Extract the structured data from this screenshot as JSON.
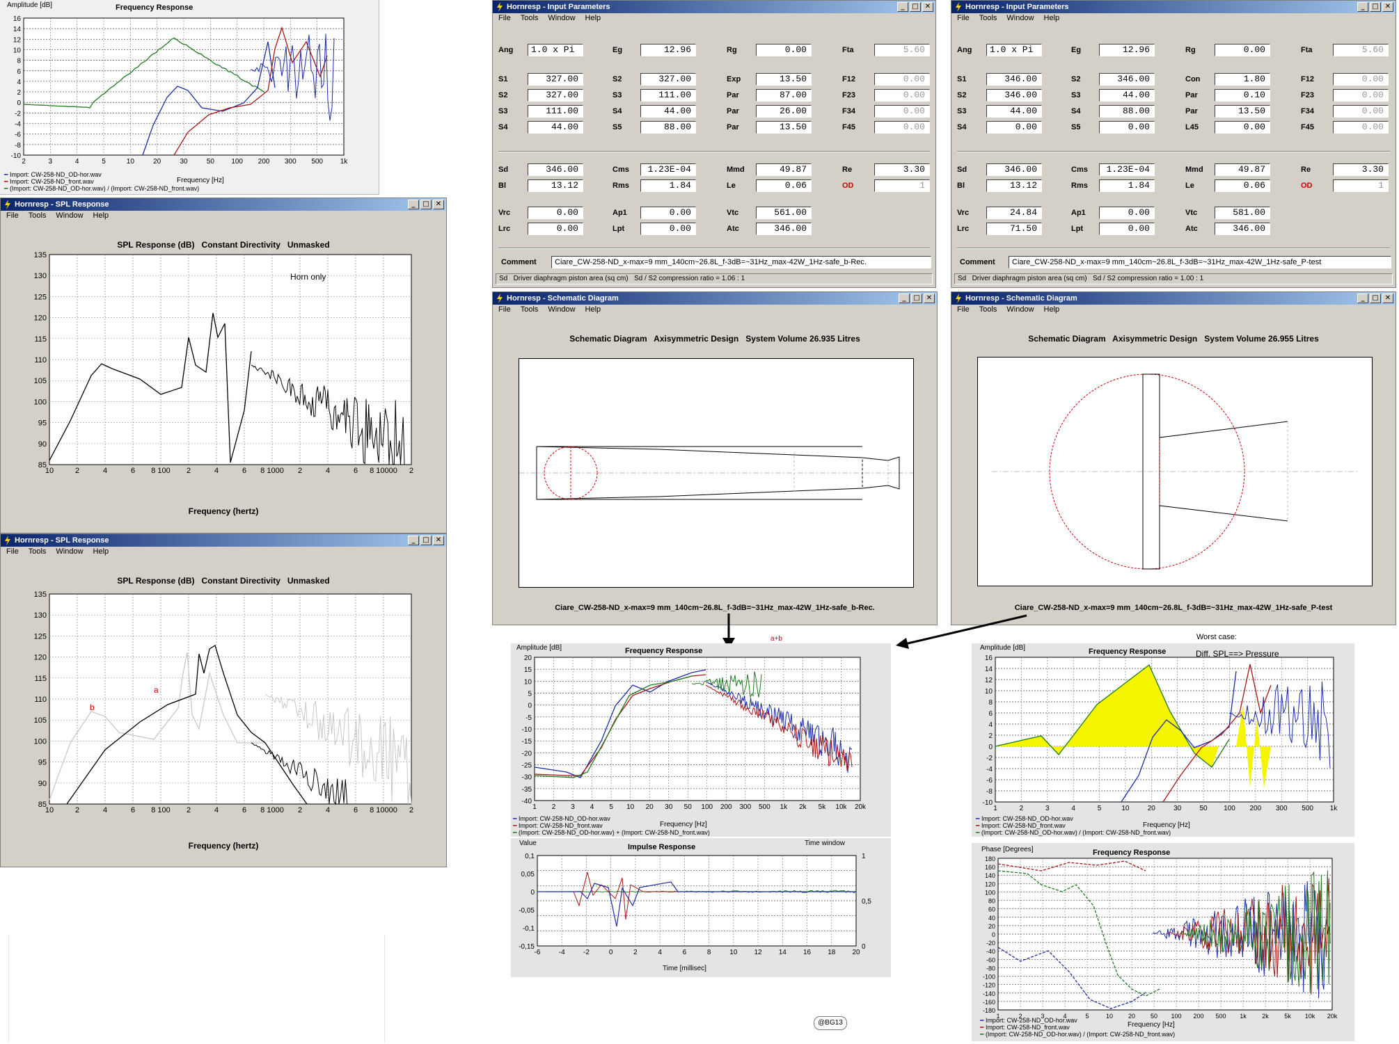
{
  "colors": {
    "blue": "#1a2aa8",
    "red": "#a81414",
    "green": "#1e7a1e",
    "yellow": "#f5f500",
    "black": "#000000",
    "gray": "#c8c8c8"
  },
  "fr_top": {
    "ylabel": "Amplitude [dB]",
    "title": "Frequency Response",
    "xlabel": "Frequency [Hz]",
    "yticks": [
      "16",
      "14",
      "12",
      "10",
      "8",
      "6",
      "4",
      "2",
      "0",
      "-2",
      "-4",
      "-6",
      "-8",
      "-10"
    ],
    "xticks": [
      "2",
      "3",
      "4",
      "5",
      "10",
      "20",
      "30",
      "50",
      "100",
      "200",
      "300",
      "500",
      "1k"
    ],
    "legend": [
      "Import: CW-258-ND_OD-hor.wav",
      "Import: CW-258-ND_front.wav",
      "(Import: CW-258-ND_OD-hor.wav) / (Import: CW-258-ND_front.wav)"
    ]
  },
  "spl1": {
    "window_title": "Hornresp - SPL Response",
    "menu": [
      "File",
      "Tools",
      "Window",
      "Help"
    ],
    "heading": "SPL Response (dB)   Constant Directivity   Unmasked",
    "annotation": "Horn only",
    "yticks": [
      "135",
      "130",
      "125",
      "120",
      "115",
      "110",
      "105",
      "100",
      "95",
      "90",
      "85"
    ],
    "xticks": [
      "10",
      "2",
      "4",
      "6",
      "8 100",
      "2",
      "4",
      "6",
      "8 1000",
      "2",
      "4",
      "6",
      "8 10000",
      "2"
    ],
    "xlabel": "Frequency (hertz)"
  },
  "spl2": {
    "window_title": "Hornresp - SPL Response",
    "menu": [
      "File",
      "Tools",
      "Window",
      "Help"
    ],
    "heading": "SPL Response (dB)   Constant Directivity   Unmasked",
    "label_a": "a",
    "label_b": "b",
    "yticks": [
      "135",
      "130",
      "125",
      "120",
      "115",
      "110",
      "105",
      "100",
      "95",
      "90",
      "85"
    ],
    "xticks": [
      "10",
      "2",
      "4",
      "6",
      "8 100",
      "2",
      "4",
      "6",
      "8 1000",
      "2",
      "4",
      "6",
      "8 10000",
      "2"
    ],
    "xlabel": "Frequency (hertz)"
  },
  "inp1": {
    "window_title": "Hornresp - Input Parameters",
    "menu": [
      "File",
      "Tools",
      "Window",
      "Help"
    ],
    "rows": [
      [
        [
          "Ang",
          "1.0 x Pi",
          "left"
        ],
        [
          "Eg",
          "12.96",
          ""
        ],
        [
          "Rg",
          "0.00",
          ""
        ],
        [
          "Fta",
          "5.60",
          "dis"
        ]
      ],
      [
        [
          "S1",
          "327.00",
          ""
        ],
        [
          "S2",
          "327.00",
          ""
        ],
        [
          "Exp",
          "13.50",
          ""
        ],
        [
          "F12",
          "0.00",
          "dis"
        ]
      ],
      [
        [
          "S2",
          "327.00",
          ""
        ],
        [
          "S3",
          "111.00",
          ""
        ],
        [
          "Par",
          "87.00",
          ""
        ],
        [
          "F23",
          "0.00",
          "dis"
        ]
      ],
      [
        [
          "S3",
          "111.00",
          ""
        ],
        [
          "S4",
          "44.00",
          ""
        ],
        [
          "Par",
          "26.00",
          ""
        ],
        [
          "F34",
          "0.00",
          "dis"
        ]
      ],
      [
        [
          "S4",
          "44.00",
          ""
        ],
        [
          "S5",
          "88.00",
          ""
        ],
        [
          "Par",
          "13.50",
          ""
        ],
        [
          "F45",
          "0.00",
          "dis"
        ]
      ],
      [
        [
          "Sd",
          "346.00",
          ""
        ],
        [
          "Cms",
          "1.23E-04",
          ""
        ],
        [
          "Mmd",
          "49.87",
          ""
        ],
        [
          "Re",
          "3.30",
          ""
        ]
      ],
      [
        [
          "Bl",
          "13.12",
          ""
        ],
        [
          "Rms",
          "1.84",
          ""
        ],
        [
          "Le",
          "0.06",
          ""
        ],
        [
          "OD",
          "1",
          "dis"
        ]
      ],
      [
        [
          "Vrc",
          "0.00",
          ""
        ],
        [
          "Ap1",
          "0.00",
          ""
        ],
        [
          "Vtc",
          "561.00",
          ""
        ]
      ],
      [
        [
          "Lrc",
          "0.00",
          ""
        ],
        [
          "Lpt",
          "0.00",
          ""
        ],
        [
          "Atc",
          "346.00",
          ""
        ]
      ]
    ],
    "comment_label": "Comment",
    "comment": "Ciare_CW-258-ND_x-max=9 mm_140cm~26.8L_f-3dB=~31Hz_max-42W_1Hz-safe_b-Rec.",
    "status": "Sd   Driver diaphragm piston area (sq cm)   Sd / S2 compression ratio = 1.06 : 1"
  },
  "inp2": {
    "window_title": "Hornresp - Input Parameters",
    "menu": [
      "File",
      "Tools",
      "Window",
      "Help"
    ],
    "rows": [
      [
        [
          "Ang",
          "1.0 x Pi",
          "left"
        ],
        [
          "Eg",
          "12.96",
          ""
        ],
        [
          "Rg",
          "0.00",
          ""
        ],
        [
          "Fta",
          "5.60",
          "dis"
        ]
      ],
      [
        [
          "S1",
          "346.00",
          ""
        ],
        [
          "S2",
          "346.00",
          ""
        ],
        [
          "Con",
          "1.80",
          ""
        ],
        [
          "F12",
          "0.00",
          "dis"
        ]
      ],
      [
        [
          "S2",
          "346.00",
          ""
        ],
        [
          "S3",
          "44.00",
          ""
        ],
        [
          "Par",
          "0.10",
          ""
        ],
        [
          "F23",
          "0.00",
          "dis"
        ]
      ],
      [
        [
          "S3",
          "44.00",
          ""
        ],
        [
          "S4",
          "88.00",
          ""
        ],
        [
          "Par",
          "13.50",
          ""
        ],
        [
          "F34",
          "0.00",
          "dis"
        ]
      ],
      [
        [
          "S4",
          "0.00",
          ""
        ],
        [
          "S5",
          "0.00",
          ""
        ],
        [
          "L45",
          "0.00",
          ""
        ],
        [
          "F45",
          "0.00",
          "dis"
        ]
      ],
      [
        [
          "Sd",
          "346.00",
          ""
        ],
        [
          "Cms",
          "1.23E-04",
          ""
        ],
        [
          "Mmd",
          "49.87",
          ""
        ],
        [
          "Re",
          "3.30",
          ""
        ]
      ],
      [
        [
          "Bl",
          "13.12",
          ""
        ],
        [
          "Rms",
          "1.84",
          ""
        ],
        [
          "Le",
          "0.06",
          ""
        ],
        [
          "OD",
          "1",
          "dis"
        ]
      ],
      [
        [
          "Vrc",
          "24.84",
          ""
        ],
        [
          "Ap1",
          "0.00",
          ""
        ],
        [
          "Vtc",
          "581.00",
          ""
        ]
      ],
      [
        [
          "Lrc",
          "71.50",
          ""
        ],
        [
          "Lpt",
          "0.00",
          ""
        ],
        [
          "Atc",
          "346.00",
          ""
        ]
      ]
    ],
    "comment_label": "Comment",
    "comment": "Ciare_CW-258-ND_x-max=9 mm_140cm~26.8L_f-3dB=~31Hz_max-42W_1Hz-safe_P-test",
    "status": "Sd   Driver diaphragm piston area (sq cm)   Sd / S2 compression ratio = 1.00 : 1"
  },
  "sch1": {
    "window_title": "Hornresp - Schematic Diagram",
    "menu": [
      "File",
      "Tools",
      "Window",
      "Help"
    ],
    "heading": "Schematic Diagram   Axisymmetric Design   System Volume 26.935 Litres",
    "caption": "Ciare_CW-258-ND_x-max=9 mm_140cm~26.8L_f-3dB=~31Hz_max-42W_1Hz-safe_b-Rec."
  },
  "sch2": {
    "window_title": "Hornresp - Schematic Diagram",
    "menu": [
      "File",
      "Tools",
      "Window",
      "Help"
    ],
    "heading": "Schematic Diagram   Axisymmetric Design   System Volume 26.955 Litres",
    "caption": "Ciare_CW-258-ND_x-max=9 mm_140cm~26.8L_f-3dB=~31Hz_max-42W_1Hz-safe_P-test"
  },
  "fr_mid": {
    "ylabel": "Amplitude [dB]",
    "title": "Frequency Response",
    "annotation": "a+b",
    "xlabel": "Frequency [Hz]",
    "yticks": [
      "20",
      "15",
      "10",
      "5",
      "0",
      "-5",
      "-10",
      "-15",
      "-20",
      "-25",
      "-30",
      "-35",
      "-40"
    ],
    "xticks": [
      "1",
      "2",
      "3",
      "4",
      "5",
      "10",
      "20",
      "30",
      "50",
      "100",
      "200",
      "300",
      "500",
      "1k",
      "2k",
      "5k",
      "10k",
      "20k"
    ],
    "legend": [
      "Import: CW-258-ND_OD-hor.wav",
      "Import: CW-258-ND_front.wav",
      "(Import: CW-258-ND_OD-hor.wav) + (Import: CW-258-ND_front.wav)"
    ]
  },
  "ir": {
    "ylabel": "Value",
    "title": "Impulse Response",
    "rlabel": "Time window",
    "xlabel": "Time [millisec]",
    "yticks": [
      "0,1",
      "0,05",
      "0",
      "-0,05",
      "-0,1",
      "-0,15"
    ],
    "rticks": [
      "1",
      "0,5",
      "0"
    ],
    "xticks": [
      "-6",
      "-4",
      "-2",
      "0",
      "2",
      "4",
      "6",
      "8",
      "10",
      "12",
      "14",
      "16",
      "18",
      "20"
    ]
  },
  "fr_right": {
    "worst_label": "Worst case:",
    "note": "Diff. SPL==> Pressure",
    "ylabel": "Amplitude [dB]",
    "title": "Frequency Response",
    "xlabel": "Frequency [Hz]",
    "yticks": [
      "16",
      "14",
      "12",
      "10",
      "8",
      "6",
      "4",
      "2",
      "0",
      "-2",
      "-4",
      "-6",
      "-8",
      "-10"
    ],
    "xticks": [
      "1",
      "2",
      "3",
      "4",
      "5",
      "10",
      "20",
      "30",
      "50",
      "100",
      "200",
      "300",
      "500",
      "1k"
    ],
    "legend": [
      "Import: CW-258-ND_OD-hor.wav",
      "Import: CW-258-ND_front.wav",
      "(Import: CW-258-ND_OD-hor.wav) / (Import: CW-258-ND_front.wav)"
    ]
  },
  "phase": {
    "ylabel": "Phase [Degrees]",
    "title": "Frequency Response",
    "xlabel": "Frequency [Hz]",
    "yticks": [
      "180",
      "160",
      "140",
      "120",
      "100",
      "80",
      "60",
      "40",
      "20",
      "0",
      "-20",
      "-40",
      "-60",
      "-80",
      "-100",
      "-120",
      "-140",
      "-160",
      "-180"
    ],
    "xticks": [
      "1",
      "2",
      "3",
      "4",
      "5",
      "10",
      "20",
      "50",
      "100",
      "200",
      "500",
      "1k",
      "2k",
      "5k",
      "10k",
      "20k"
    ],
    "legend": [
      "Import: CW-258-ND_OD-hor.wav",
      "Import: CW-258-ND_front.wav",
      "(Import: CW-258-ND_OD-hor.wav) / (Import: CW-258-ND_front.wav)"
    ]
  },
  "signature": "@BG13"
}
